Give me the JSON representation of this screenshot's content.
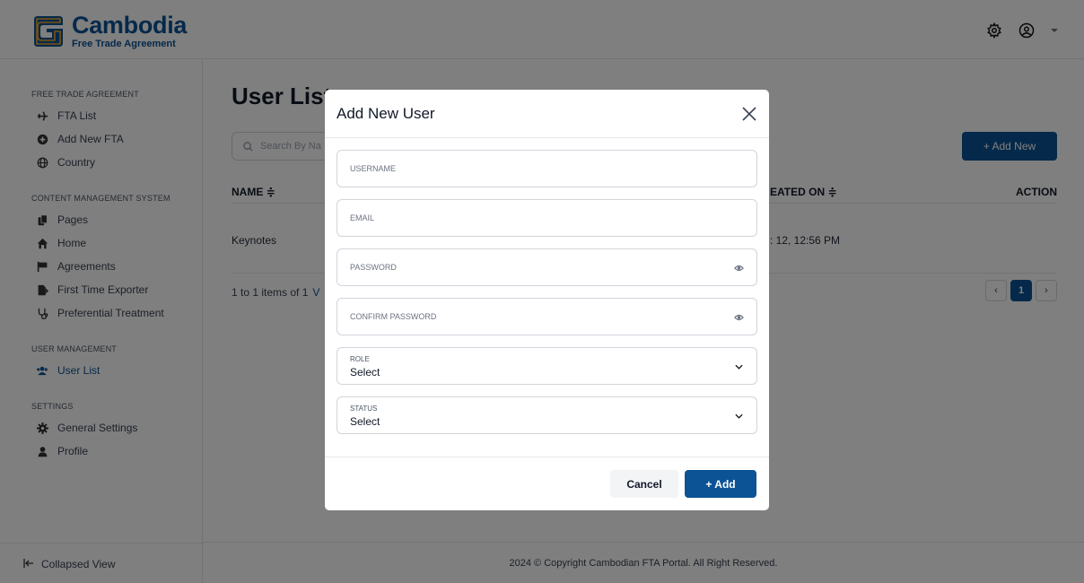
{
  "brand": {
    "title": "Cambodia",
    "subtitle": "Free Trade Agreement"
  },
  "header": {
    "icons": [
      "gear-icon",
      "user-circle-icon",
      "caret-down-icon"
    ]
  },
  "sidebar": {
    "sections": [
      {
        "title": "FREE TRADE AGREEMENT",
        "items": [
          {
            "label": "FTA List",
            "icon": "plane-icon"
          },
          {
            "label": "Add New FTA",
            "icon": "plus-circle-icon"
          },
          {
            "label": "Country",
            "icon": "globe-icon"
          }
        ]
      },
      {
        "title": "CONTENT MANAGEMENT SYSTEM",
        "items": [
          {
            "label": "Pages",
            "icon": "copy-icon"
          },
          {
            "label": "Home",
            "icon": "home-icon"
          },
          {
            "label": "Agreements",
            "icon": "flag-icon"
          },
          {
            "label": "First Time Exporter",
            "icon": "file-export-icon"
          },
          {
            "label": "Preferential Treatment",
            "icon": "stethoscope-icon"
          }
        ]
      },
      {
        "title": "USER MANAGEMENT",
        "items": [
          {
            "label": "User List",
            "icon": "users-icon",
            "active": true
          }
        ]
      },
      {
        "title": "SETTINGS",
        "items": [
          {
            "label": "General Settings",
            "icon": "cog-icon"
          },
          {
            "label": "Profile",
            "icon": "user-icon"
          }
        ]
      }
    ],
    "collapse_label": "Collapsed View"
  },
  "main": {
    "page_title": "User List",
    "search_placeholder": "Search By Na",
    "add_new_label": "+ Add New",
    "columns": {
      "name": "NAME ≑",
      "created_on": "EATED ON ≑",
      "action": "ACTION"
    },
    "row": {
      "name": "Keynotes",
      "created_on": ": 12, 12:56 PM"
    },
    "pagination": {
      "summary": "1 to 1 items of 1",
      "view": "V",
      "current_page": "1",
      "prev": "‹",
      "next": "›"
    },
    "footer": "2024 © Copyright Cambodian FTA Portal. All Right Reserved."
  },
  "modal": {
    "title": "Add New User",
    "fields": {
      "username_placeholder": "USERNAME",
      "email_placeholder": "EMAIL",
      "password_placeholder": "PASSWORD",
      "confirm_placeholder": "CONFIRM PASSWORD",
      "role_label": "ROLE",
      "role_value": "Select",
      "status_label": "STATUS",
      "status_value": "Select"
    },
    "cancel_label": "Cancel",
    "add_label": "+ Add"
  },
  "colors": {
    "primary": "#0b5394",
    "overlay": "rgba(0,0,0,0.5)"
  }
}
